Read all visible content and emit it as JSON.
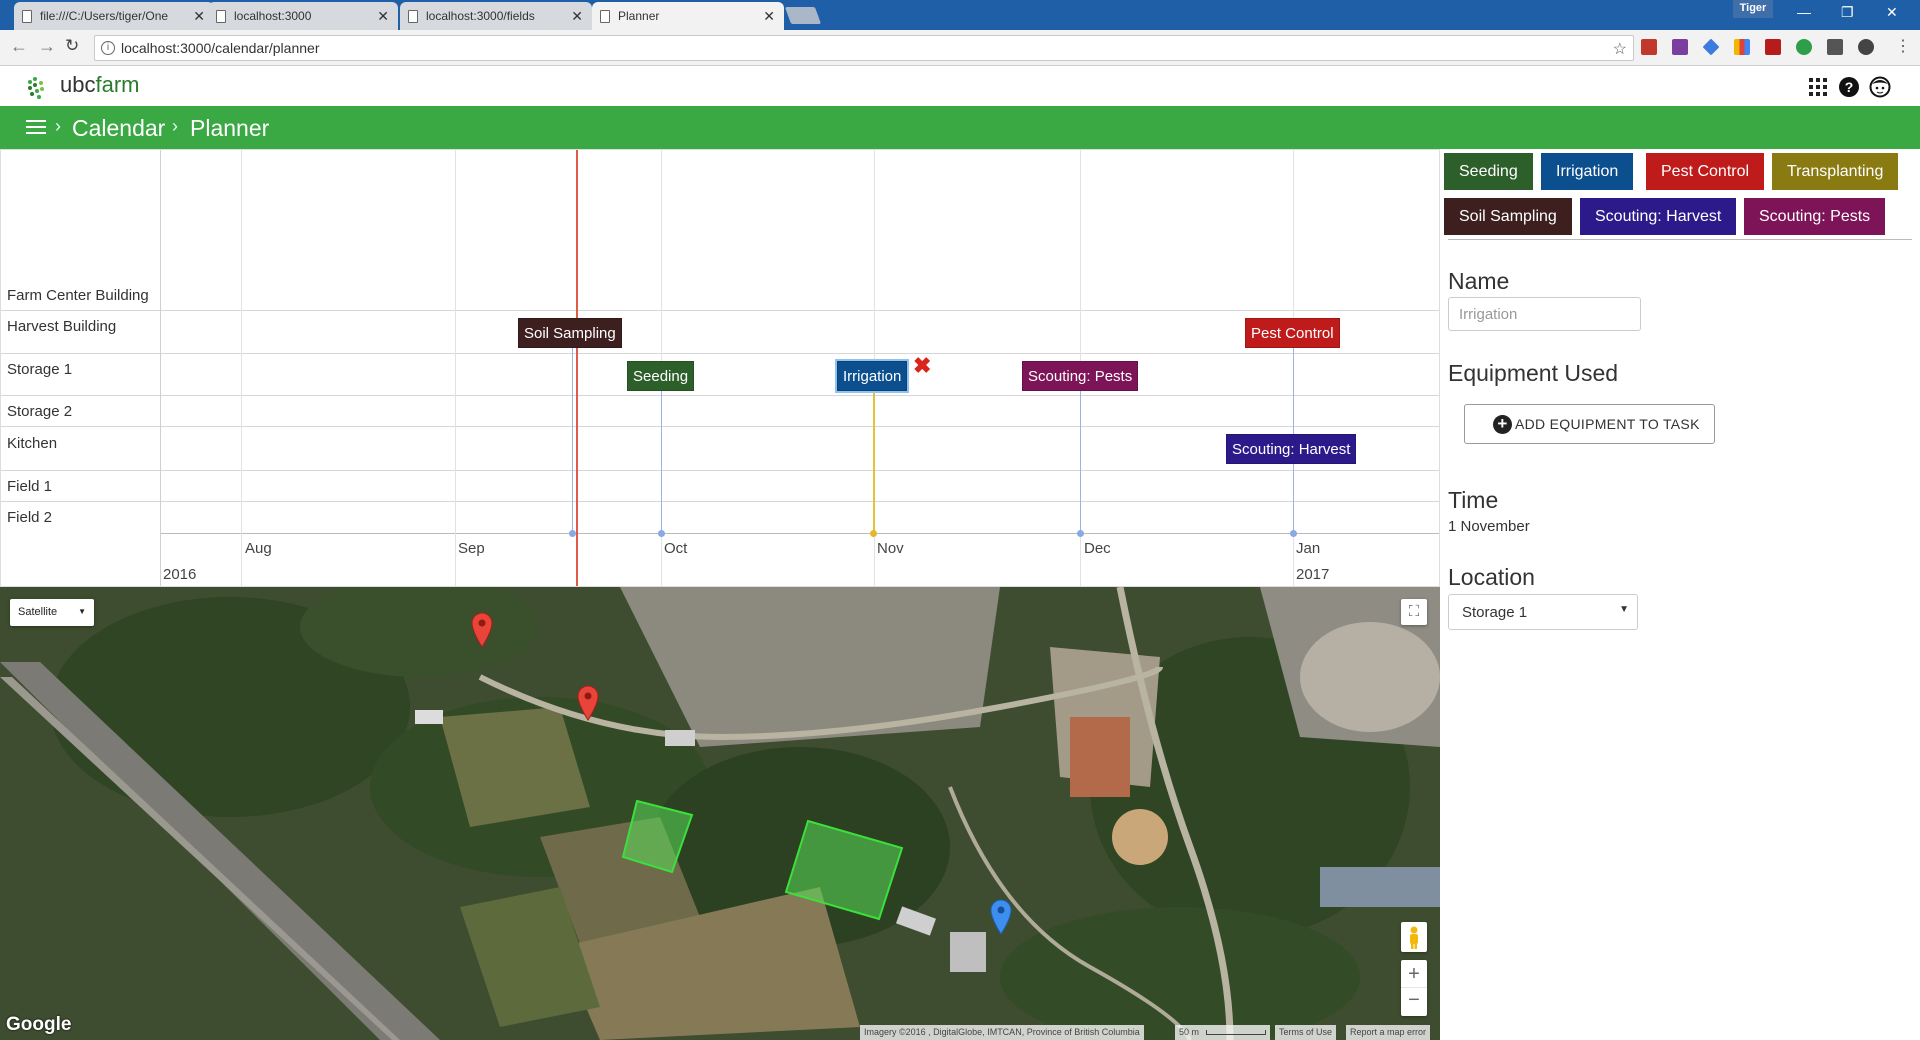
{
  "browser": {
    "tabs": [
      {
        "title": "file:///C:/Users/tiger/One"
      },
      {
        "title": "localhost:3000"
      },
      {
        "title": "localhost:3000/fields"
      },
      {
        "title": "Planner"
      }
    ],
    "profile": "Tiger",
    "url": "localhost:3000/calendar/planner"
  },
  "app": {
    "logo_text_ubc": "ubc",
    "logo_text_farm": "farm",
    "breadcrumb": [
      "Calendar",
      "Planner"
    ]
  },
  "timeline": {
    "rows": [
      "Farm Center Building",
      "Harvest Building",
      "Storage 1",
      "Storage 2",
      "Kitchen",
      "Field 1",
      "Field 2"
    ],
    "months": [
      "Aug",
      "Sep",
      "Oct",
      "Nov",
      "Dec",
      "Jan"
    ],
    "years": [
      "2016",
      "2017"
    ],
    "events": [
      {
        "label": "Soil Sampling",
        "row": "Harvest Building",
        "date": "2016-09-23",
        "color": "#3d1f1f"
      },
      {
        "label": "Seeding",
        "row": "Storage 1",
        "date": "2016-10-01",
        "color": "#2d5f2a"
      },
      {
        "label": "Irrigation",
        "row": "Storage 1",
        "date": "2016-11-01",
        "color": "#0c4f8f",
        "selected": true
      },
      {
        "label": "Scouting: Pests",
        "row": "Storage 1",
        "date": "2016-12-01",
        "color": "#7d1457"
      },
      {
        "label": "Pest Control",
        "row": "Harvest Building",
        "date": "2017-01-01",
        "color": "#c01b1b"
      },
      {
        "label": "Scouting: Harvest",
        "row": "Kitchen",
        "date": "2017-01-01",
        "color": "#2c1a8a"
      }
    ],
    "delete_glyph": "✖"
  },
  "task_types": [
    {
      "label": "Seeding",
      "color": "#2d5f2a"
    },
    {
      "label": "Irrigation",
      "color": "#0c4f8f"
    },
    {
      "label": "Pest Control",
      "color": "#c01b1b"
    },
    {
      "label": "Transplanting",
      "color": "#8a7a12"
    },
    {
      "label": "Soil Sampling",
      "color": "#3d1f1f"
    },
    {
      "label": "Scouting: Harvest",
      "color": "#2c1a8a"
    },
    {
      "label": "Scouting: Pests",
      "color": "#7d1457"
    }
  ],
  "form": {
    "name_title": "Name",
    "name_placeholder": "Irrigation",
    "equipment_title": "Equipment Used",
    "equipment_button": "ADD EQUIPMENT TO TASK",
    "time_title": "Time",
    "time_value": "1 November",
    "location_title": "Location",
    "location_value": "Storage 1"
  },
  "map": {
    "type_selector": "Satellite",
    "google": "Google",
    "attribution": "Imagery ©2016 , DigitalGlobe, IMTCAN, Province of British Columbia",
    "scale": "50 m",
    "terms": "Terms of Use",
    "report": "Report a map error"
  }
}
